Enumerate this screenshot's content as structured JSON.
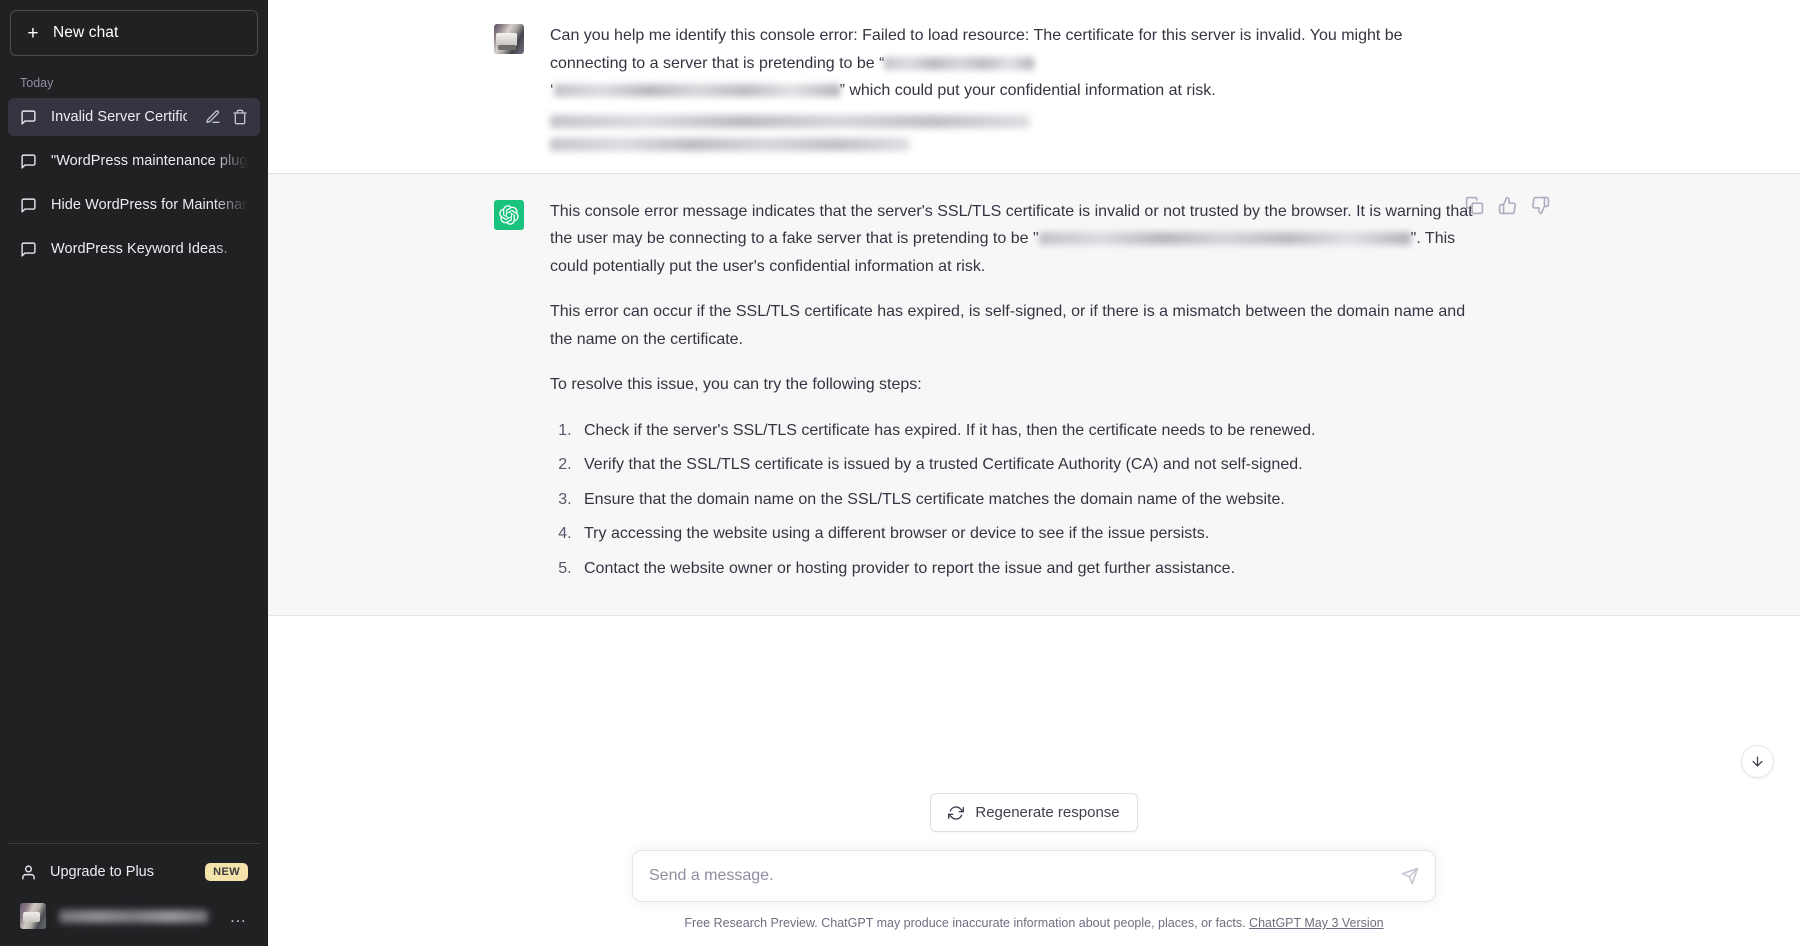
{
  "sidebar": {
    "new_chat_label": "New chat",
    "section_label": "Today",
    "chats": [
      {
        "title": "Invalid Server Certificat",
        "icon": "chat-bubble-icon",
        "active": true
      },
      {
        "title": "\"WordPress maintenance plugi",
        "icon": "chat-bubble-icon",
        "active": false
      },
      {
        "title": "Hide WordPress for Maintenan",
        "icon": "chat-bubble-icon",
        "active": false
      },
      {
        "title": "WordPress Keyword Ideas.",
        "icon": "chat-bubble-icon",
        "active": false
      }
    ],
    "upgrade_label": "Upgrade to Plus",
    "upgrade_badge": "NEW",
    "account_name_redacted": true,
    "account_menu_icon": "ellipsis-icon"
  },
  "conversation": {
    "user_message": {
      "text_part1": "Can you help me identify this console error: Failed to load resource: The certificate for this server is invalid. You might be connecting to a server that is pretending to be “",
      "text_part2": "” which could put your confidential information at risk.",
      "redacted_inline_1": true,
      "redacted_inline_2": true,
      "redacted_trailing_lines": 2
    },
    "assistant_message": {
      "paragraph1_part1": "This console error message indicates that the server's SSL/TLS certificate is invalid or not trusted by the browser. It is warning that the user may be connecting to a fake server that is pretending to be \"",
      "paragraph1_part2": "\". This could potentially put the user's confidential information at risk.",
      "paragraph2": "This error can occur if the SSL/TLS certificate has expired, is self-signed, or if there is a mismatch between the domain name and the name on the certificate.",
      "paragraph3": "To resolve this issue, you can try the following steps:",
      "steps": [
        "Check if the server's SSL/TLS certificate has expired. If it has, then the certificate needs to be renewed.",
        "Verify that the SSL/TLS certificate is issued by a trusted Certificate Authority (CA) and not self-signed.",
        "Ensure that the domain name on the SSL/TLS certificate matches the domain name of the website.",
        "Try accessing the website using a different browser or device to see if the issue persists.",
        "Contact the website owner or hosting provider to report the issue and get further assistance."
      ],
      "actions": [
        "copy-icon",
        "thumbs-up-icon",
        "thumbs-down-icon"
      ]
    }
  },
  "composer": {
    "regenerate_label": "Regenerate response",
    "regenerate_icon": "refresh-icon",
    "input_placeholder": "Send a message.",
    "input_value": "",
    "send_icon": "send-icon",
    "scroll_icon": "arrow-down-icon"
  },
  "footer": {
    "note": "Free Research Preview. ChatGPT may produce inaccurate information about people, places, or facts.",
    "version_link": "ChatGPT May 3 Version"
  },
  "colors": {
    "sidebar_bg": "#202123",
    "active_chat_bg": "#343541",
    "assistant_bg": "#f7f7f8",
    "user_bg": "#ffffff",
    "gpt_green": "#19c37d",
    "badge_yellow": "#f4e3ab",
    "text_primary": "#343541",
    "text_muted": "#8e8ea0"
  }
}
